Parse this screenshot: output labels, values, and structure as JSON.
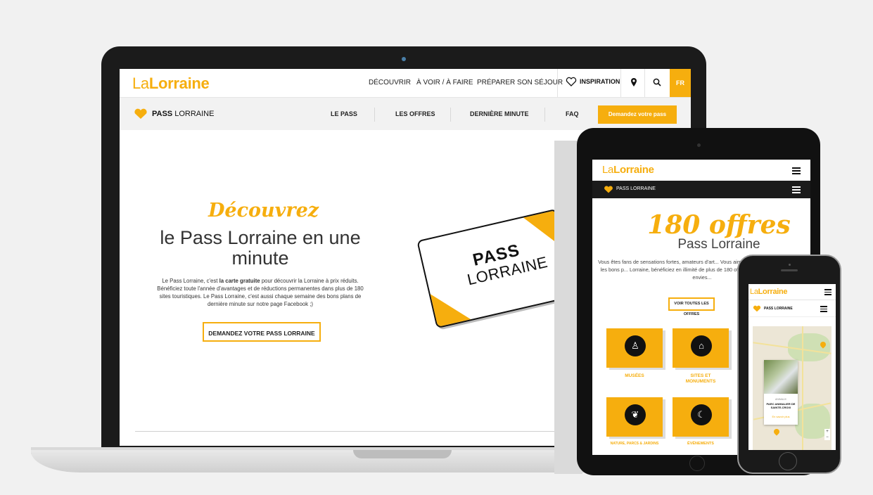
{
  "brand": {
    "logo_light": "La",
    "logo_bold": "Lorraine",
    "accent": "#f6ae0e"
  },
  "laptop": {
    "nav": [
      "DÉCOUVRIR",
      "À VOIR / À FAIRE",
      "PRÉPARER SON SÉJOUR"
    ],
    "inspiration": "INSPIRATION",
    "lang": "FR",
    "pass_title_bold": "PASS",
    "pass_title_rest": " LORRAINE",
    "subnav": [
      "LE PASS",
      "LES OFFRES",
      "DERNIÈRE MINUTE",
      "FAQ"
    ],
    "cta": "Demandez votre pass",
    "hero_script": "Découvrez",
    "hero_title": "le Pass Lorraine en une minute",
    "hero_text_1": "Le Pass Lorraine, c'est ",
    "hero_text_bold": "la carte gratuite",
    "hero_text_2": " pour découvrir la Lorraine à prix réduits. Bénéficiez toute l'année d'avantages et de réductions permanentes dans plus de 180 sites touristiques. Le Pass Lorraine, c'est aussi chaque semaine des bons plans de dernière minute sur notre page Facebook ;)",
    "hero_button": "DEMANDEZ VOTRE PASS LORRAINE",
    "card_line1": "PASS",
    "card_line2": "LORRAINE"
  },
  "tablet": {
    "pass_title": "PASS LORRAINE",
    "script": "180 offres",
    "title": "Pass Lorraine",
    "text": "Vous êtes fans de sensations fortes, amateurs d'art... Vous aimez la nature, le patrimoine et les bons p... Lorraine, bénéficiez en illimité de plus de 180 offres... Lorraine au gré de vos envies...",
    "button": "VOIR TOUTES LES OFFRES",
    "tiles": [
      {
        "label": "MUSÉES"
      },
      {
        "label": "SITES ET MONUMENTS"
      },
      {
        "label": "NATURE, PARCS & JARDINS"
      },
      {
        "label": "ÉVÉNEMENTS"
      }
    ]
  },
  "phone": {
    "pass_title": "PASS LORRAINE",
    "popup_kicker": "ANIMAUX",
    "popup_title": "PARC ANIMALIER DE SAINTE-CROIX",
    "popup_link": "En savoir plus",
    "zoom_in": "+",
    "zoom_out": "−"
  },
  "icons": [
    "heart-outline-icon",
    "map-pin-icon",
    "search-icon",
    "menu-icon",
    "heart-icon",
    "museum-icon",
    "monument-icon",
    "leaf-icon",
    "event-icon"
  ]
}
